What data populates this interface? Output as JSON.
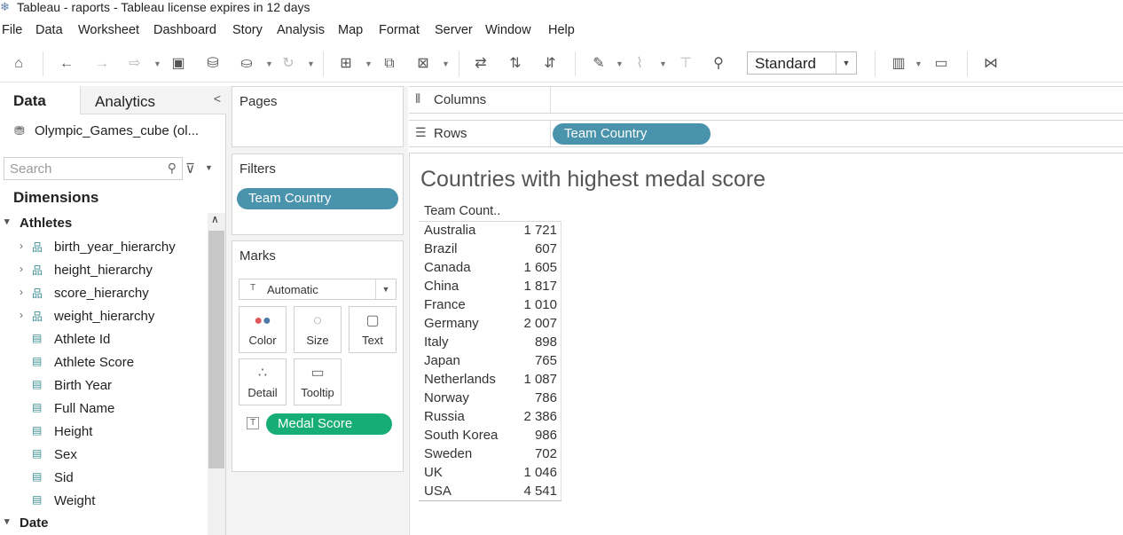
{
  "window": {
    "title": "Tableau - raports - Tableau license expires in 12 days"
  },
  "menu": [
    "File",
    "Data",
    "Worksheet",
    "Dashboard",
    "Story",
    "Analysis",
    "Map",
    "Format",
    "Server",
    "Window",
    "Help"
  ],
  "toolbar": {
    "fit_mode": "Standard"
  },
  "data_pane": {
    "tab_data": "Data",
    "tab_analytics": "Analytics",
    "datasource": "Olympic_Games_cube (ol...",
    "search_placeholder": "Search",
    "dimensions_header": "Dimensions",
    "group_athletes": "Athletes",
    "fields": [
      "birth_year_hierarchy",
      "height_hierarchy",
      "score_hierarchy",
      "weight_hierarchy",
      "Athlete Id",
      "Athlete Score",
      "Birth Year",
      "Full Name",
      "Height",
      "Sex",
      "Sid",
      "Weight"
    ],
    "group_date": "Date"
  },
  "cards": {
    "pages": "Pages",
    "filters": "Filters",
    "filter_pill": "Team Country",
    "marks": "Marks",
    "mark_type": "Automatic",
    "mark_buttons": [
      "Color",
      "Size",
      "Text",
      "Detail",
      "Tooltip"
    ],
    "marks_pill": "Medal Score"
  },
  "shelves": {
    "columns": "Columns",
    "rows": "Rows",
    "rows_pill": "Team Country"
  },
  "view": {
    "title": "Countries with highest medal score",
    "column_header": "Team Count..",
    "rows": [
      {
        "country": "Australia",
        "value": "1 721"
      },
      {
        "country": "Brazil",
        "value": "607"
      },
      {
        "country": "Canada",
        "value": "1 605"
      },
      {
        "country": "China",
        "value": "1 817"
      },
      {
        "country": "France",
        "value": "1 010"
      },
      {
        "country": "Germany",
        "value": "2 007"
      },
      {
        "country": "Italy",
        "value": "898"
      },
      {
        "country": "Japan",
        "value": "765"
      },
      {
        "country": "Netherlands",
        "value": "1 087"
      },
      {
        "country": "Norway",
        "value": "786"
      },
      {
        "country": "Russia",
        "value": "2 386"
      },
      {
        "country": "South Korea",
        "value": "986"
      },
      {
        "country": "Sweden",
        "value": "702"
      },
      {
        "country": "UK",
        "value": "1 046"
      },
      {
        "country": "USA",
        "value": "4 541"
      }
    ]
  }
}
